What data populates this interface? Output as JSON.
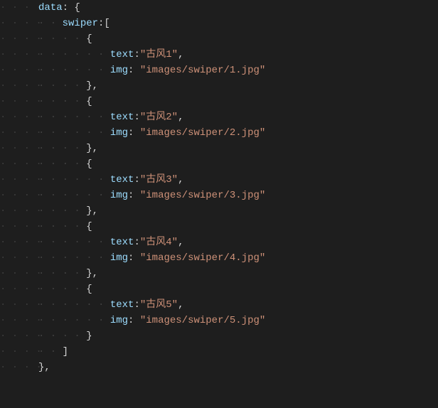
{
  "gutter": "· · · · ",
  "indentDots": "· · ",
  "code": {
    "data_key": "data",
    "swiper_key": "swiper",
    "text_key": "text",
    "img_key": "img",
    "items": [
      {
        "text": "古风1",
        "img": "images/swiper/1.jpg"
      },
      {
        "text": "古风2",
        "img": "images/swiper/2.jpg"
      },
      {
        "text": "古风3",
        "img": "images/swiper/3.jpg"
      },
      {
        "text": "古风4",
        "img": "images/swiper/4.jpg"
      },
      {
        "text": "古风5",
        "img": "images/swiper/5.jpg"
      }
    ]
  }
}
